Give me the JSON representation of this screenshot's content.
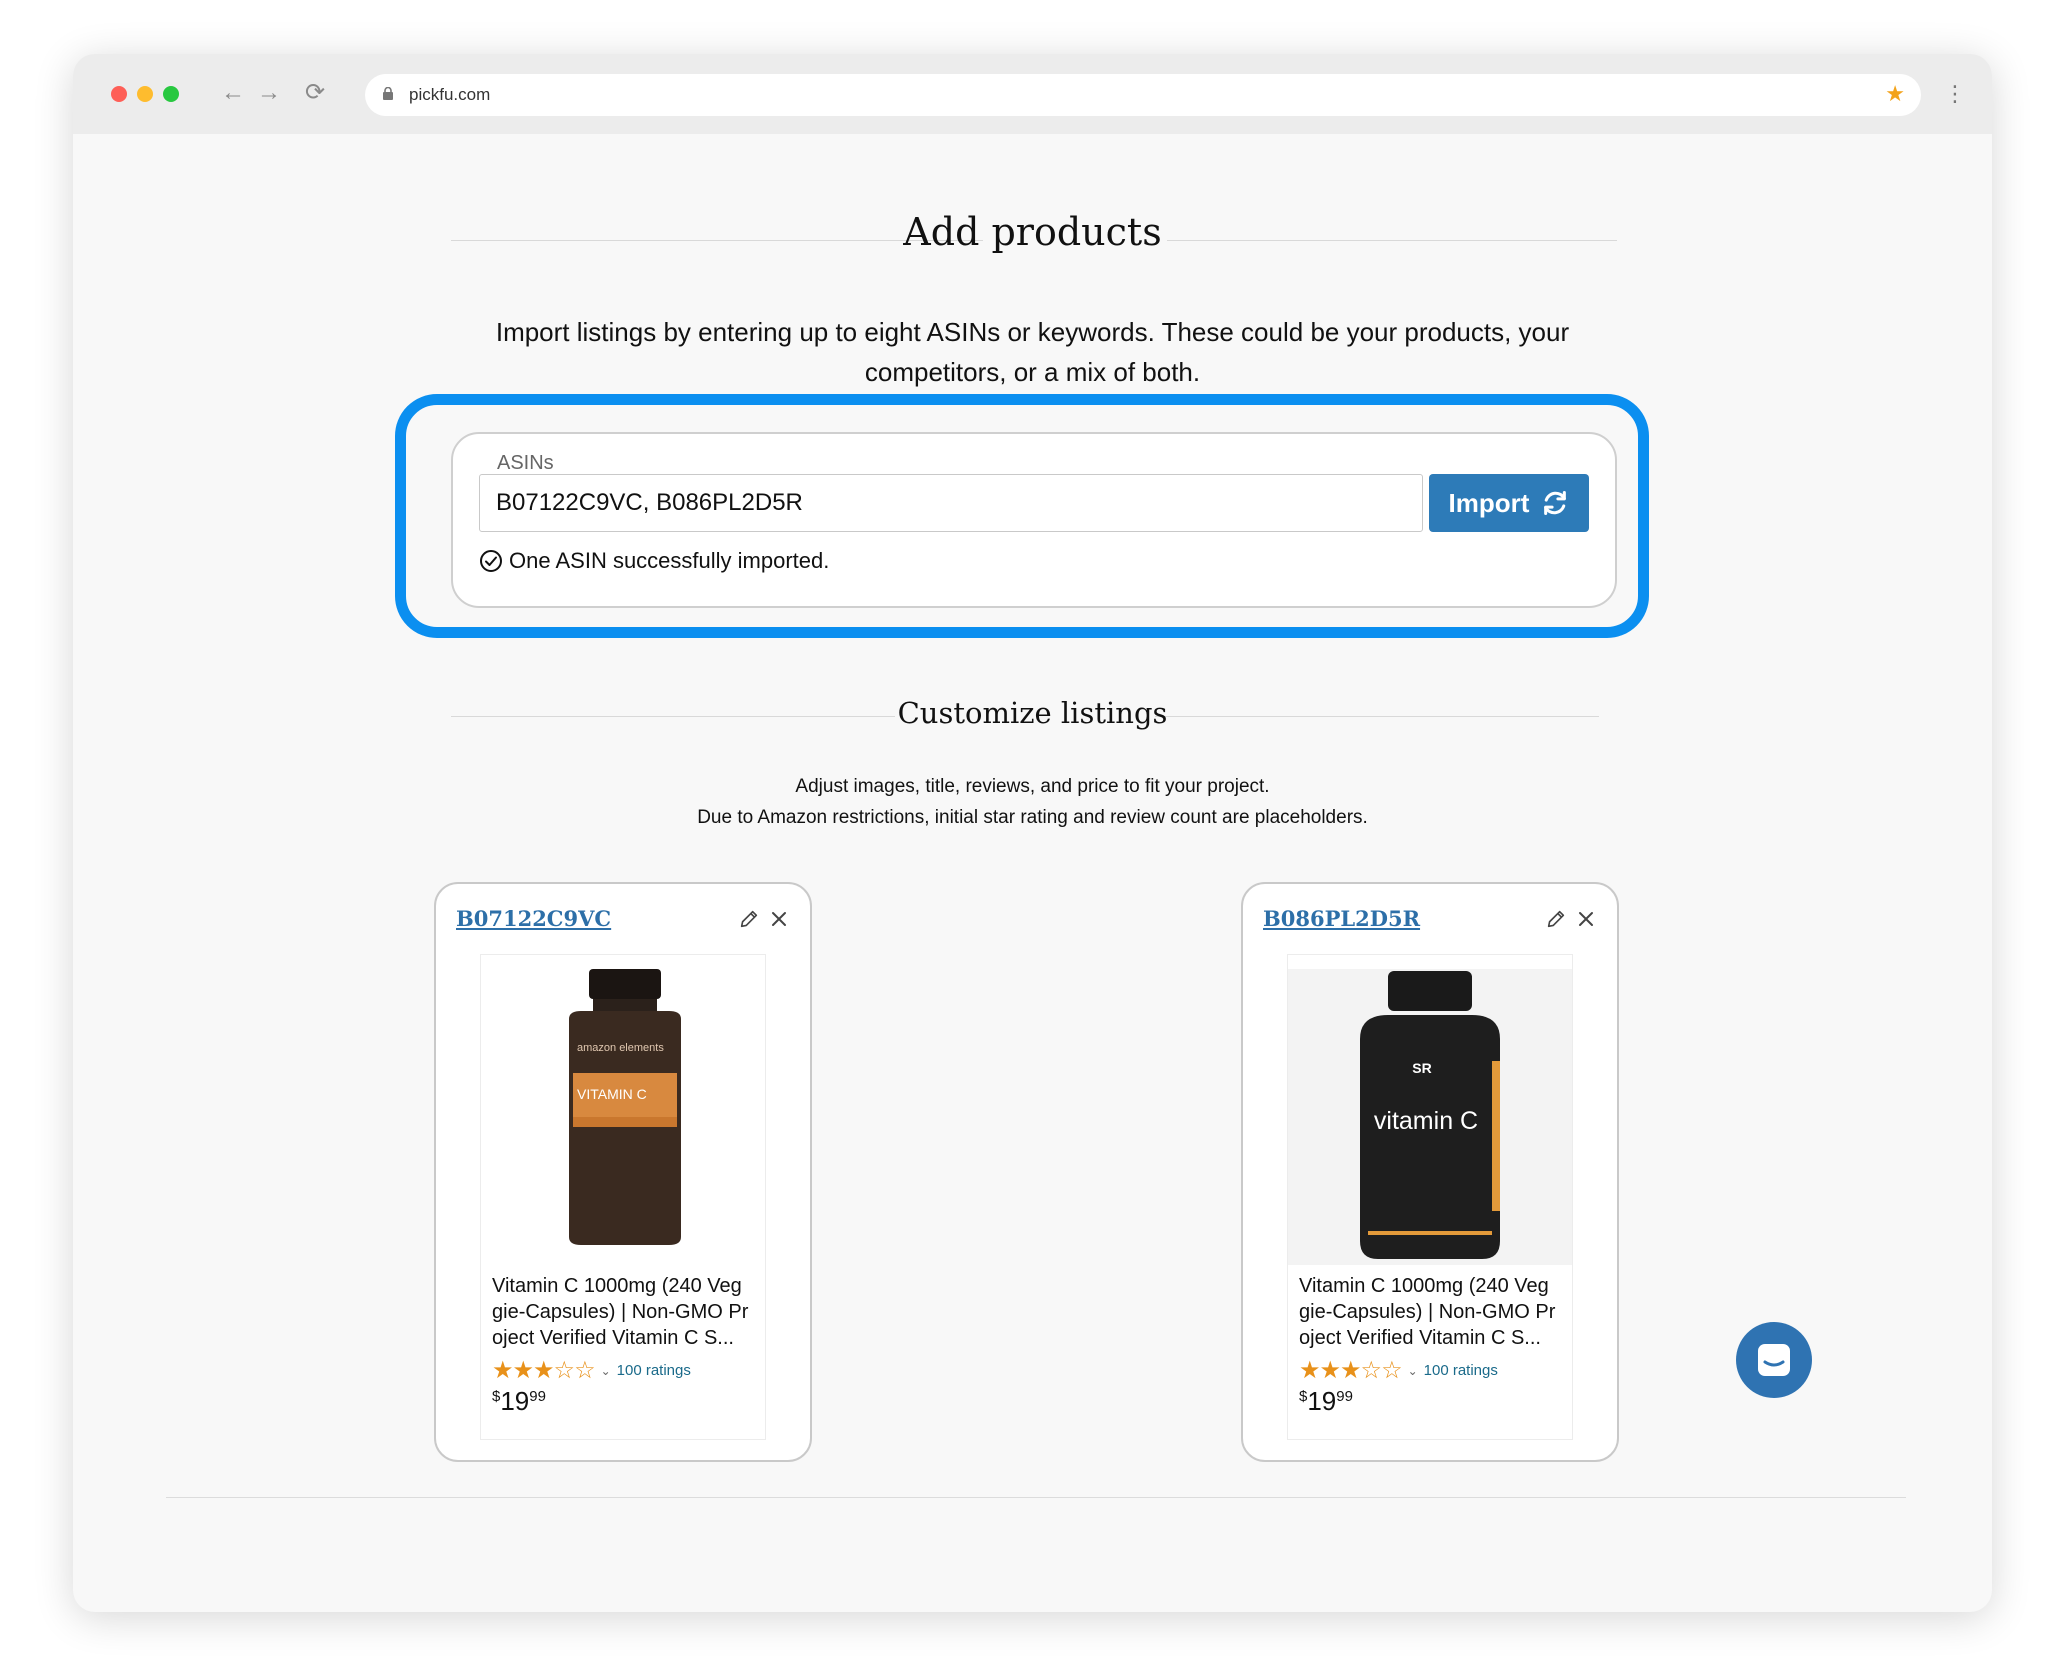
{
  "browser": {
    "url": "pickfu.com",
    "nav": {
      "back": "←",
      "forward": "→",
      "reload": "⟳"
    },
    "bookmark_icon": "★",
    "menu_icon": "⋮"
  },
  "add_products": {
    "title": "Add products",
    "description_line1": "Import listings by entering up to eight ASINs or keywords. These could be your products, your",
    "description_line2": "competitors, or a mix of both.",
    "field_label": "ASINs",
    "input_value": "B07122C9VC, B086PL2D5R",
    "import_label": "Import",
    "status_message": "One ASIN successfully imported."
  },
  "customize": {
    "title": "Customize listings",
    "line1": "Adjust images, title, reviews, and price to fit your project.",
    "line2": "Due to Amazon restrictions, initial star rating and review count are placeholders."
  },
  "products": [
    {
      "asin": "B07122C9VC",
      "title": "Vitamin C 1000mg (240 Veg gie-Capsules) | Non-GMO Pr oject Verified Vitamin C S...",
      "stars": "★★★☆☆",
      "rating_count": "100 ratings",
      "price_currency": "$",
      "price_whole": "19",
      "price_cents": "99",
      "label_brand": "amazon elements",
      "label_name": "VITAMIN C"
    },
    {
      "asin": "B086PL2D5R",
      "title": "Vitamin C 1000mg (240 Veg gie-Capsules) | Non-GMO Pr oject Verified Vitamin C S...",
      "stars": "★★★☆☆",
      "rating_count": "100 ratings",
      "price_currency": "$",
      "price_whole": "19",
      "price_cents": "99",
      "label_brand": "SR",
      "label_name": "vitamin C"
    }
  ],
  "colors": {
    "highlight": "#0b8ff0",
    "primary_button": "#2d7bb8",
    "link": "#2d6fa8",
    "star": "#e8911a"
  },
  "icons": {
    "edit": "pencil-icon",
    "remove": "close-icon",
    "refresh": "refresh-icon",
    "success": "check-circle-icon",
    "chat": "chat-icon"
  }
}
